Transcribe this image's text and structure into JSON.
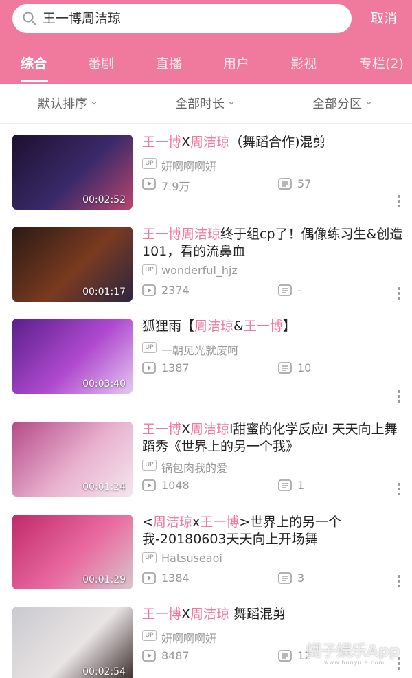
{
  "search": {
    "query": "王一博周洁琼",
    "cancel_label": "取消",
    "icon": "search-icon"
  },
  "tabs": [
    {
      "label": "综合",
      "active": true
    },
    {
      "label": "番剧",
      "active": false
    },
    {
      "label": "直播",
      "active": false
    },
    {
      "label": "用户",
      "active": false
    },
    {
      "label": "影视",
      "active": false
    },
    {
      "label": "专栏(2)",
      "active": false
    }
  ],
  "filters": [
    {
      "label": "默认排序"
    },
    {
      "label": "全部时长"
    },
    {
      "label": "全部分区"
    }
  ],
  "badge_label": "UP",
  "results": [
    {
      "title_parts": [
        {
          "t": "王一博",
          "hl": true
        },
        {
          "t": "X",
          "hl": false
        },
        {
          "t": "周洁琼",
          "hl": true
        },
        {
          "t": "（舞蹈合作)混剪",
          "hl": false
        }
      ],
      "uploader": "妍啊啊啊妍",
      "views": "7.9万",
      "danmaku": "57",
      "duration": "00:02:52",
      "thumb_colors": [
        "#1c1030",
        "#3a2a6a",
        "#b8466e"
      ]
    },
    {
      "title_parts": [
        {
          "t": "王一博周洁琼",
          "hl": true
        },
        {
          "t": "终于组cp了！偶像练习生&创造101，看的流鼻血",
          "hl": false
        }
      ],
      "uploader": "wonderful_hjz",
      "views": "2374",
      "danmaku": "-",
      "duration": "00:01:17",
      "thumb_colors": [
        "#2a1a14",
        "#7a3a20",
        "#2e2540"
      ]
    },
    {
      "title_parts": [
        {
          "t": "狐狸雨【",
          "hl": false
        },
        {
          "t": "周洁琼",
          "hl": true
        },
        {
          "t": "&",
          "hl": false
        },
        {
          "t": "王一博",
          "hl": true
        },
        {
          "t": "】",
          "hl": false
        }
      ],
      "uploader": "一朝见光就废呵",
      "views": "1387",
      "danmaku": "10",
      "duration": "00:03:40",
      "thumb_colors": [
        "#5a1f8a",
        "#b04ad0",
        "#e6c6f2"
      ]
    },
    {
      "title_parts": [
        {
          "t": "王一博",
          "hl": true
        },
        {
          "t": "X",
          "hl": false
        },
        {
          "t": "周洁琼",
          "hl": true
        },
        {
          "t": "l甜蜜的化学反应l 天天向上舞蹈秀《世界上的另一个我》",
          "hl": false
        }
      ],
      "uploader": "锅包肉我的爱",
      "views": "1048",
      "danmaku": "1",
      "duration": "00:01:24",
      "thumb_colors": [
        "#b64a8a",
        "#e9b2cf",
        "#f4e6ee"
      ]
    },
    {
      "title_parts": [
        {
          "t": "<",
          "hl": false
        },
        {
          "t": "周洁琼",
          "hl": true
        },
        {
          "t": "x",
          "hl": false
        },
        {
          "t": "王一博",
          "hl": true
        },
        {
          "t": ">世界上的另一个我-20180603天天向上开场舞",
          "hl": false
        }
      ],
      "uploader": "Hatsuseaoi",
      "views": "1384",
      "danmaku": "3",
      "duration": "00:01:29",
      "thumb_colors": [
        "#c02a6a",
        "#e96aa0",
        "#d8c6cc"
      ]
    },
    {
      "title_parts": [
        {
          "t": "王一博",
          "hl": true
        },
        {
          "t": "X",
          "hl": false
        },
        {
          "t": "周洁琼",
          "hl": true
        },
        {
          "t": " 舞蹈混剪",
          "hl": false
        }
      ],
      "uploader": "妍啊啊啊妍",
      "views": "8487",
      "danmaku": "12",
      "duration": "00:02:54",
      "thumb_colors": [
        "#c9c9cf",
        "#e9e4e4",
        "#3a2a2a"
      ]
    }
  ],
  "watermark": {
    "text": "蝴子娱乐App",
    "sub": "www.hunyule.com"
  },
  "colors": {
    "accent": "#f07a9e",
    "header_bg": "#f07a9e",
    "muted": "#999999"
  }
}
